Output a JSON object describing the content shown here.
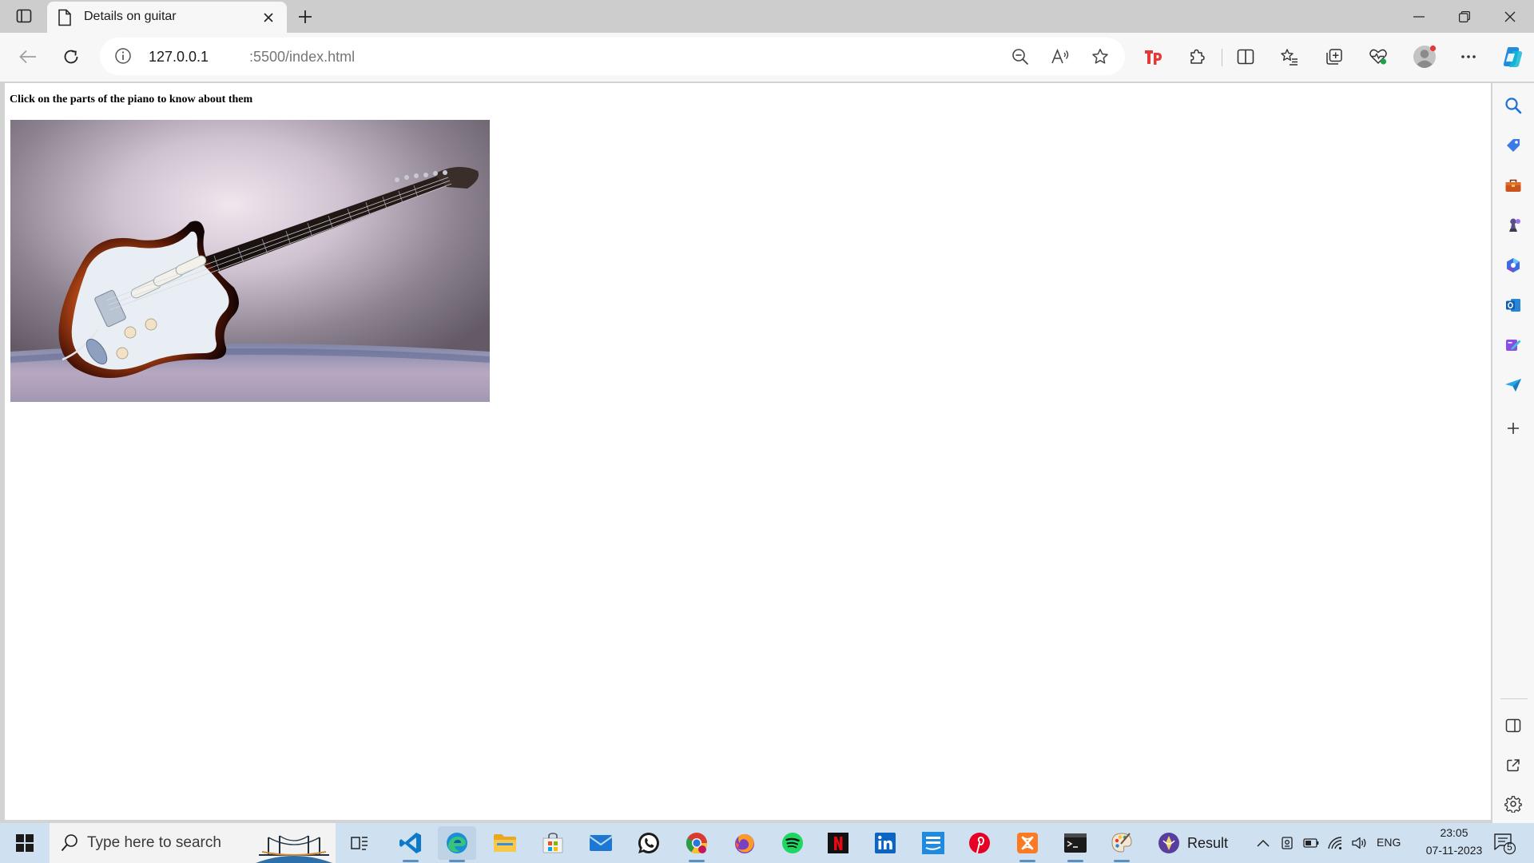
{
  "browser": {
    "tab": {
      "title": "Details on guitar"
    },
    "address": {
      "host": "127.0.0.1",
      "path": ":5500/index.html"
    }
  },
  "page": {
    "heading": "Click on the parts of the piano to know about them"
  },
  "taskbar": {
    "search_placeholder": "Type here to search",
    "widget_label": "Result",
    "language": "ENG",
    "time": "23:05",
    "date": "07-11-2023",
    "notification_count": "5"
  },
  "colors": {
    "tab_strip": "#cdcdcd",
    "toolbar": "#f7f7f7",
    "taskbar": "#cfe0f0",
    "accent_edge": "#0c59a4"
  }
}
